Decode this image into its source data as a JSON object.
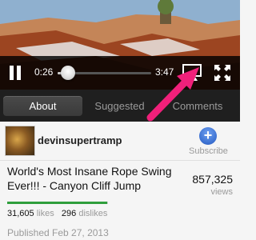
{
  "player": {
    "current_time": "0:26",
    "duration": "3:47",
    "progress_fraction": 0.115,
    "play_state": "playing",
    "icons": {
      "play_pause": "pause-icon",
      "airplay": "airplay-icon",
      "fullscreen": "fullscreen-icon"
    }
  },
  "tabs": [
    {
      "label": "About",
      "active": true
    },
    {
      "label": "Suggested",
      "active": false
    },
    {
      "label": "Comments",
      "active": false
    }
  ],
  "channel": {
    "name": "devinsupertramp",
    "subscribe_label": "Subscribe",
    "subscribe_icon": "plus-icon"
  },
  "video": {
    "title": "World's Most Insane Rope Swing Ever!!! - Canyon Cliff Jump",
    "views_count": "857,325",
    "views_label": "views",
    "likes_count": "31,605",
    "likes_label": "likes",
    "dislikes_count": "296",
    "dislikes_label": "dislikes",
    "like_fraction": 0.991,
    "published": "Published Feb 27, 2013"
  },
  "colors": {
    "annotation_arrow": "#f0207a",
    "like_bar": "#2f9e3c",
    "subscribe_button": "#3a6fd0"
  }
}
